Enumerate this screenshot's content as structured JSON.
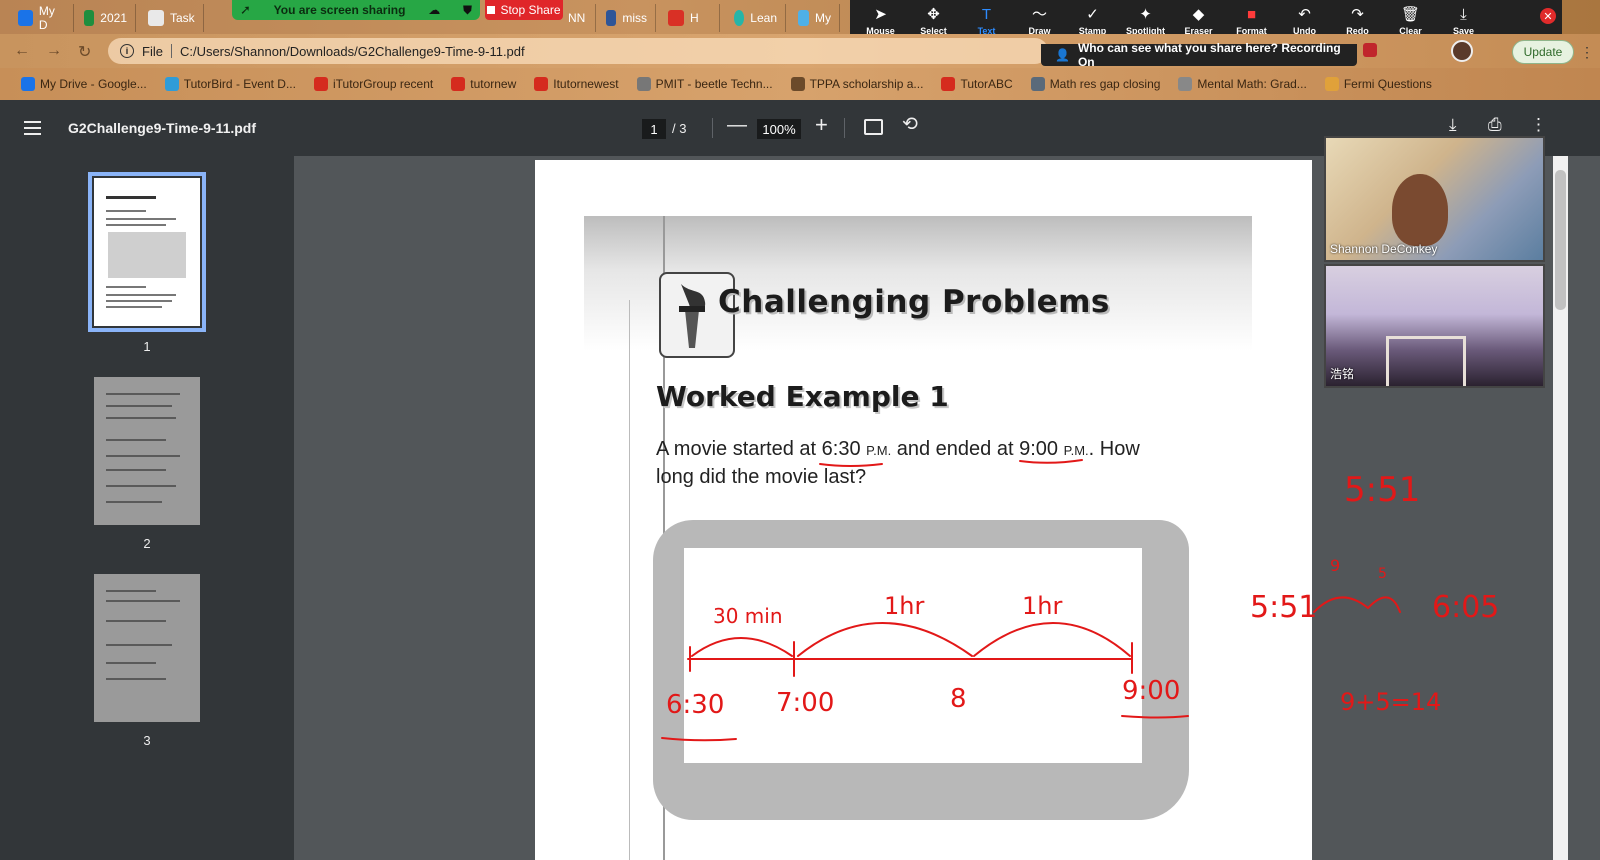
{
  "browser": {
    "tabs": [
      {
        "label": "My D",
        "color": "#1a73e8"
      },
      {
        "label": "2021",
        "color": "#1e8e3e"
      },
      {
        "label": "Task",
        "color": "#e9e9e9"
      },
      {
        "label": "NN",
        "color": "#333333"
      },
      {
        "label": "miss",
        "color": "#2f5597"
      },
      {
        "label": "H",
        "color": "#d93025"
      },
      {
        "label": "Lean",
        "color": "#26b5a8"
      },
      {
        "label": "My",
        "color": "#4fb0e6"
      }
    ],
    "address": {
      "scheme": "File",
      "url": "C:/Users/Shannon/Downloads/G2Challenge9-Time-9-11.pdf"
    },
    "update_label": "Update",
    "bookmarks": [
      {
        "label": "My Drive - Google...",
        "color": "#1a73e8"
      },
      {
        "label": "TutorBird - Event D...",
        "color": "#2f9cd8"
      },
      {
        "label": "iTutorGroup recent",
        "color": "#d52b1e"
      },
      {
        "label": "tutornew",
        "color": "#d52b1e"
      },
      {
        "label": "Itutornewest",
        "color": "#d52b1e"
      },
      {
        "label": "PMIT - beetle Techn...",
        "color": "#777777"
      },
      {
        "label": "TPPA scholarship a...",
        "color": "#6b4a2a"
      },
      {
        "label": "TutorABC",
        "color": "#d52b1e"
      },
      {
        "label": "Math res gap closing",
        "color": "#5a6a7a"
      },
      {
        "label": "Mental Math: Grad...",
        "color": "#888888"
      },
      {
        "label": "Fermi Questions",
        "color": "#e0a13a"
      }
    ]
  },
  "zoom": {
    "share_banner": "You are screen sharing",
    "stop_share": "Stop Share",
    "who_can_see": "Who can see what you share here? Recording On",
    "toolbar": [
      {
        "label": "Mouse",
        "icon": "cursor-icon",
        "glyph": "➤"
      },
      {
        "label": "Select",
        "icon": "move-icon",
        "glyph": "✥"
      },
      {
        "label": "Text",
        "icon": "text-icon",
        "glyph": "T"
      },
      {
        "label": "Draw",
        "icon": "draw-icon",
        "glyph": "〜"
      },
      {
        "label": "Stamp",
        "icon": "stamp-icon",
        "glyph": "✓"
      },
      {
        "label": "Spotlight",
        "icon": "spotlight-icon",
        "glyph": "✦"
      },
      {
        "label": "Eraser",
        "icon": "eraser-icon",
        "glyph": "◆"
      },
      {
        "label": "Format",
        "icon": "format-icon",
        "glyph": "■"
      },
      {
        "label": "Undo",
        "icon": "undo-icon",
        "glyph": "↶"
      },
      {
        "label": "Redo",
        "icon": "redo-icon",
        "glyph": "↷"
      },
      {
        "label": "Clear",
        "icon": "trash-icon",
        "glyph": "🗑"
      },
      {
        "label": "Save",
        "icon": "save-icon",
        "glyph": "⤓"
      }
    ],
    "participants": [
      {
        "name": "Shannon DeConkey"
      },
      {
        "name": "浩铭"
      }
    ]
  },
  "pdf": {
    "title": "G2Challenge9-Time-9-11.pdf",
    "current_page": "1",
    "total_pages": "/  3",
    "zoom": "100%",
    "thumbnails": [
      "1",
      "2",
      "3"
    ]
  },
  "worksheet": {
    "heading": "Challenging Problems",
    "example_title": "Worked Example 1",
    "question_line1_a": "A movie started at ",
    "start_time": "6:30",
    "pm1": "P.M.",
    "question_line1_b": " and ended at ",
    "end_time": "9:00",
    "pm2": "P.M.",
    "question_line1_c": ". How",
    "question_line2": "long did the movie last?"
  },
  "annotations": {
    "seg1": "30 min",
    "seg2": "1hr",
    "seg3": "1hr",
    "t1": "6:30",
    "t2": "7:00",
    "t3": "8",
    "t4": "9:00",
    "side1": "5:51",
    "side2_left": "5:51",
    "side2_right": "6:05",
    "side2_a": "9",
    "side2_b": "5",
    "side3": "9+5=14",
    "ink_color": "#e21818"
  }
}
